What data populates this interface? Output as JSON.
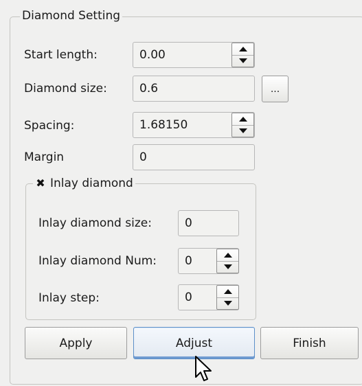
{
  "diamond_setting": {
    "title": "Diamond Setting",
    "start_length": {
      "label": "Start length:",
      "value": "0.00"
    },
    "diamond_size": {
      "label": "Diamond size:",
      "value": "0.6",
      "browse_label": "..."
    },
    "spacing": {
      "label": "Spacing:",
      "value": "1.68150"
    },
    "margin": {
      "label": "Margin",
      "value": "0"
    }
  },
  "inlay": {
    "checkbox_label": "Inlay diamond",
    "checked": true,
    "size": {
      "label": "Inlay diamond size:",
      "value": "0"
    },
    "num": {
      "label": "Inlay diamond Num:",
      "value": "0"
    },
    "step": {
      "label": "Inlay step:",
      "value": "0"
    }
  },
  "buttons": {
    "apply": "Apply",
    "adjust": "Adjust",
    "finish": "Finish"
  },
  "icons": {
    "checkbox_mark": "✖",
    "cursor": "arrow-pointer-icon"
  }
}
